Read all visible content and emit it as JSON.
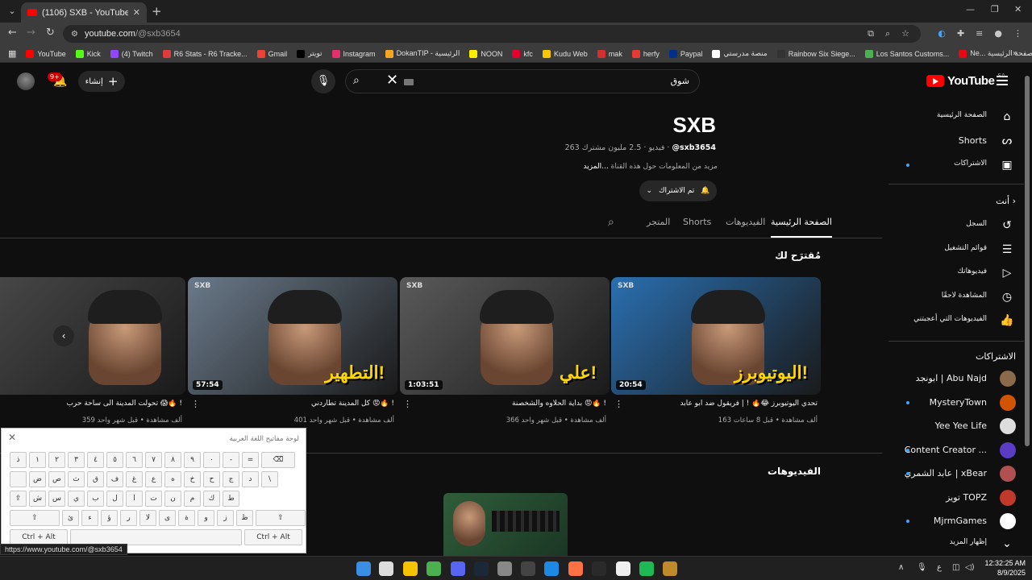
{
  "browser": {
    "tab_title": "(1106) SXB - YouTube",
    "address_host": "youtube.com",
    "address_path": "/@sxb3654",
    "bookmarks": [
      {
        "label": "YouTube",
        "color": "#ff0000"
      },
      {
        "label": "Kick",
        "color": "#53fc18"
      },
      {
        "label": "(4) Twitch",
        "color": "#9146ff"
      },
      {
        "label": "R6 Stats - R6 Tracke...",
        "color": "#e03c3c"
      },
      {
        "label": "Gmail",
        "color": "#ea4335"
      },
      {
        "label": "تويتر",
        "color": "#000000"
      },
      {
        "label": "Instagram",
        "color": "#e1306c"
      },
      {
        "label": "DokanTIP - الرئيسية",
        "color": "#f5a623"
      },
      {
        "label": "NOON",
        "color": "#feee00"
      },
      {
        "label": "kfc",
        "color": "#e4002b"
      },
      {
        "label": "Kudu Web",
        "color": "#f7c600"
      },
      {
        "label": "mak",
        "color": "#d32f2f"
      },
      {
        "label": "herfy",
        "color": "#e53935"
      },
      {
        "label": "Paypal",
        "color": "#003087"
      },
      {
        "label": "منصة مدرستي",
        "color": "#ffffff"
      },
      {
        "label": "Rainbow Six Siege...",
        "color": "#333333"
      },
      {
        "label": "Los Santos Customs...",
        "color": "#4caf50"
      },
      {
        "label": "Ne... الصفحة الرئيسية",
        "color": "#e50914"
      }
    ],
    "status_url": "https://www.youtube.com/@sxb3654"
  },
  "header": {
    "logo_text": "YouTube",
    "region": "SA",
    "search_query": "شوق",
    "create_label": "إنشاء",
    "notification_count": "9+"
  },
  "sidebar": {
    "main": [
      {
        "label": "الصفحة الرئيسية",
        "icon": "home-icon"
      },
      {
        "label": "Shorts",
        "icon": "shorts-icon"
      },
      {
        "label": "الاشتراكات",
        "icon": "subscriptions-icon"
      }
    ],
    "you_heading": "أنت",
    "you": [
      {
        "label": "السجل",
        "icon": "history-icon"
      },
      {
        "label": "قوائم التشغيل",
        "icon": "playlist-icon"
      },
      {
        "label": "فيديوهاتك",
        "icon": "your-videos-icon"
      },
      {
        "label": "المشاهدة لاحقًا",
        "icon": "watch-later-icon"
      },
      {
        "label": "الفيديوهات التي أعجبتني",
        "icon": "like-icon"
      }
    ],
    "subs_heading": "الاشتراكات",
    "subs": [
      {
        "label": "ابونجد | Abu Najd",
        "color": "#8a6a4a"
      },
      {
        "label": "MysteryTown",
        "color": "#d35400"
      },
      {
        "label": "Yee Yee Life",
        "color": "#dddddd"
      },
      {
        "label": "Content Creator ...",
        "color": "#5b3cc4"
      },
      {
        "label": "عابد الشمري | xBear",
        "color": "#b05050"
      },
      {
        "label": "تويز TOPZ",
        "color": "#c0392b"
      },
      {
        "label": "MjrmGames",
        "color": "#ffffff"
      }
    ],
    "show_more": "إظهار المزيد"
  },
  "channel": {
    "name": "SXB",
    "handle": "@sxb3654",
    "subscribers": "2.5 مليون مشترك",
    "videos": "263 فيديو",
    "description": "مزيد من المعلومات حول هذه القناة",
    "more": "...المزيد",
    "subscribed_label": "تم الاشتراك",
    "tabs": [
      "الصفحة الرئيسية",
      "الفيديوهات",
      "Shorts",
      "المتجر"
    ]
  },
  "sections": {
    "recommended_title": "مُقترَح لك",
    "videos_title": "الفيديوهات"
  },
  "videos": [
    {
      "title": "تحدي اليوتيوبرز 😂🔥 ! | فريقول ضد ابو عابد",
      "meta": "163 ألف مشاهدة • قبل 8 ساعات",
      "duration": "20:54",
      "headline": "اليوتيوبرز!",
      "bg": "#2a6fb0"
    },
    {
      "title": "بداية الحلاوه والشخصنة 😡🔥 !",
      "meta": "366 ألف مشاهدة • قبل شهر واحد",
      "duration": "1:03:51",
      "headline": "علي!",
      "bg": "#5a5a5a"
    },
    {
      "title": "كل المدينة تطاردني 😡🔥 !",
      "meta": "401 ألف مشاهدة • قبل شهر واحد",
      "duration": "57:54",
      "headline": "التطهير!",
      "bg": "#6a7a8a"
    },
    {
      "title": "تحولت المدينة الى ساحة حرب 😱🔥 !",
      "meta": "359 ألف مشاهدة • قبل شهر واحد",
      "duration": "",
      "headline": "",
      "bg": "#4a4a4a"
    }
  ],
  "keyboard": {
    "title": "لوحة مفاتيح اللغة العربية",
    "row1": [
      "ذ",
      "١",
      "٢",
      "٣",
      "٤",
      "٥",
      "٦",
      "٧",
      "٨",
      "٩",
      "٠",
      "-",
      "="
    ],
    "row2": [
      "ض",
      "ص",
      "ث",
      "ق",
      "ف",
      "غ",
      "ع",
      "ه",
      "خ",
      "ح",
      "ج",
      "د",
      "\\"
    ],
    "row3": [
      "ش",
      "س",
      "ي",
      "ب",
      "ل",
      "ا",
      "ت",
      "ن",
      "م",
      "ك",
      "ط"
    ],
    "row4": [
      "ئ",
      "ء",
      "ؤ",
      "ر",
      "لا",
      "ى",
      "ة",
      "و",
      "ز",
      "ظ"
    ],
    "alt_label": "Ctrl + Alt"
  },
  "taskbar": {
    "time": "12:32:25 AM",
    "date": "8/9/2025",
    "lang": "ع"
  }
}
